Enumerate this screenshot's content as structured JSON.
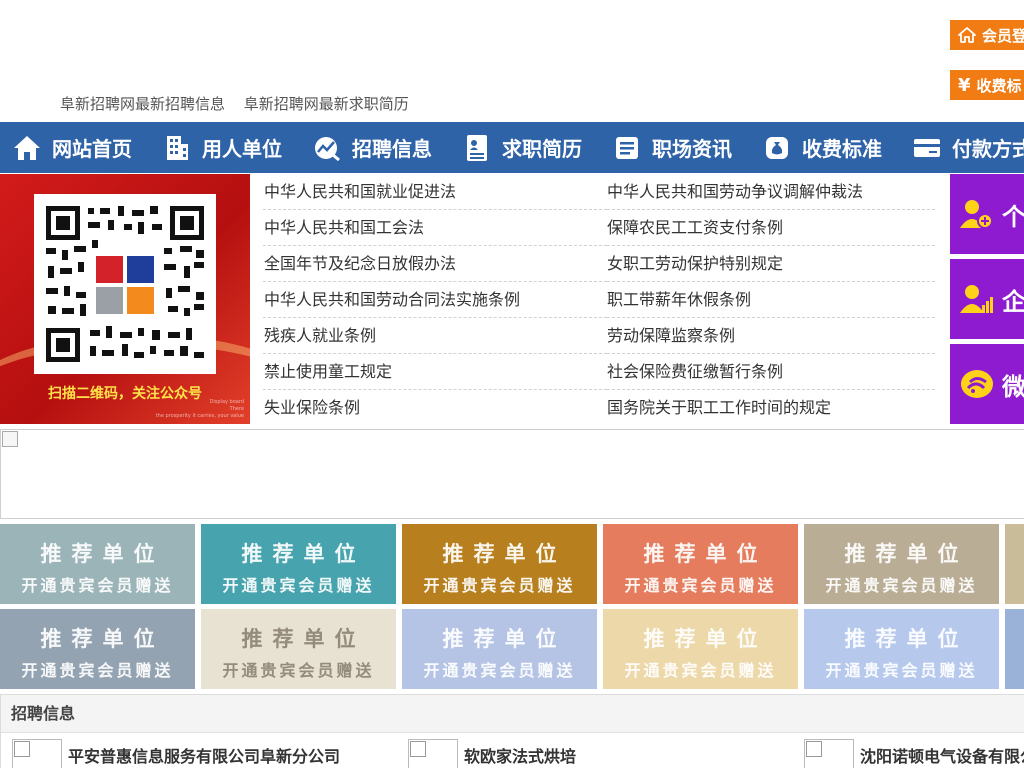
{
  "header": {
    "links": [
      "阜新招聘网最新招聘信息",
      "阜新招聘网最新求职简历"
    ],
    "member_login": "会员登",
    "fee_standard": "收费标"
  },
  "nav": {
    "items": [
      {
        "label": "网站首页",
        "icon": "home-icon"
      },
      {
        "label": "用人单位",
        "icon": "building-icon"
      },
      {
        "label": "招聘信息",
        "icon": "chart-icon"
      },
      {
        "label": "求职简历",
        "icon": "resume-icon"
      },
      {
        "label": "职场资讯",
        "icon": "news-icon"
      },
      {
        "label": "收费标准",
        "icon": "money-bag-icon"
      },
      {
        "label": "付款方式",
        "icon": "card-icon"
      }
    ]
  },
  "qr": {
    "caption": "扫描二维码，关注公众号",
    "small_text": [
      "Display board",
      "There",
      "the prosperity it carries, your value"
    ]
  },
  "laws": [
    [
      "中华人民共和国就业促进法",
      "中华人民共和国劳动争议调解仲裁法"
    ],
    [
      "中华人民共和国工会法",
      "保障农民工工资支付条例"
    ],
    [
      "全国年节及纪念日放假办法",
      "女职工劳动保护特别规定"
    ],
    [
      "中华人民共和国劳动合同法实施条例",
      "职工带薪年休假条例"
    ],
    [
      "残疾人就业条例",
      "劳动保障监察条例"
    ],
    [
      "禁止使用童工规定",
      "社会保险费征缴暂行条例"
    ],
    [
      "失业保险条例",
      "国务院关于职工工作时间的规定"
    ]
  ],
  "side": {
    "personal": "个",
    "enterprise": "企",
    "wechat": "微"
  },
  "recommend": {
    "title": "推荐单位",
    "subtitle": "开通贵宾会员赠送",
    "colors": [
      "#9bb4b8",
      "#47a3ad",
      "#b77f1d",
      "#e47c5d",
      "#b9ae95",
      "#c9bd99",
      "#93a3b1",
      "#e8e2d3",
      "#b5c4e4",
      "#ecd8a9",
      "#b6c8ec",
      "#9bb2d8"
    ]
  },
  "jobs": {
    "title": "招聘信息",
    "items": [
      "平安普惠信息服务有限公司阜新分公司",
      "软欧家法式烘培",
      "沈阳诺顿电气设备有限公司"
    ]
  }
}
